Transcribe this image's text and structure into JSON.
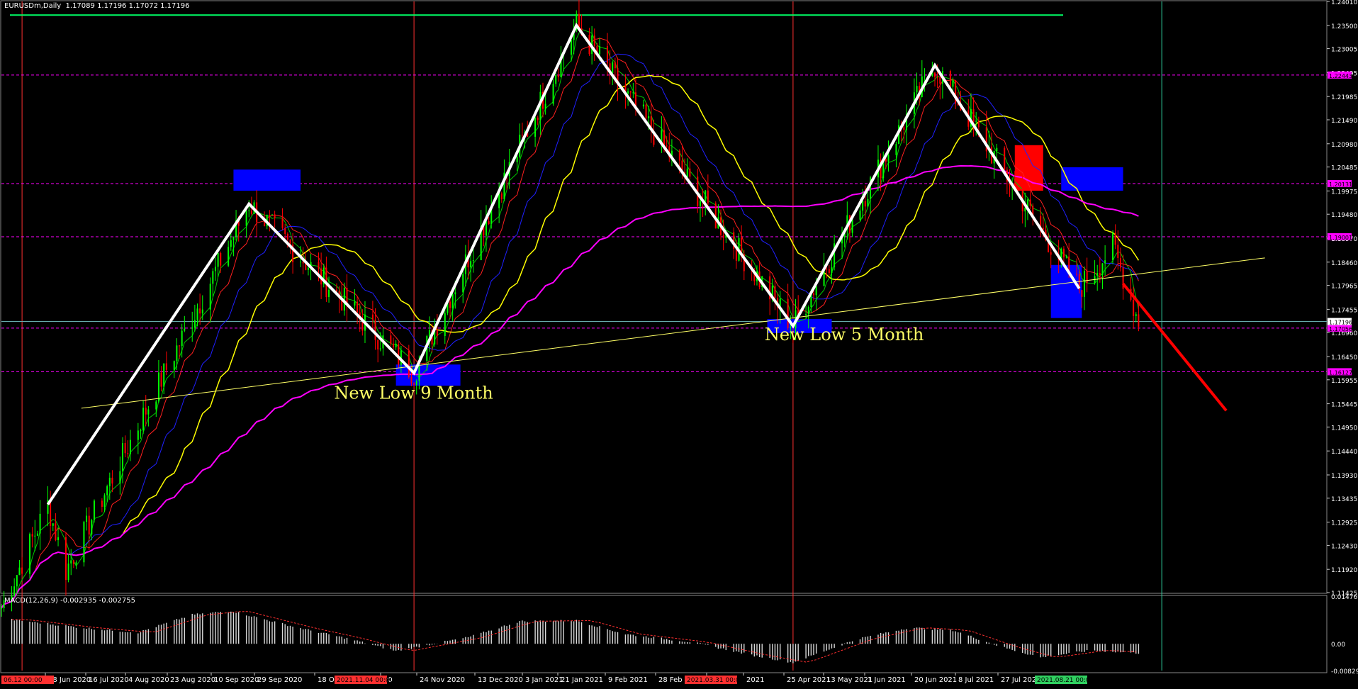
{
  "window": {
    "title": "EURUSDm,Daily  1.17089 1.17196 1.17072 1.17196"
  },
  "macd": {
    "header": "MACD(12,26,9) -0.002935 -0.002755"
  },
  "colors": {
    "background": "#000000",
    "bull": "#00ff00",
    "bear": "#ff0000",
    "ma_fast": "#00c800",
    "ma_mid": "#ff2020",
    "ma_slow": "#2020ff",
    "ma_yellow": "#ffff00",
    "ma_magenta": "#ff00ff",
    "trendline": "#ffff66",
    "zigzag": "#ffffff",
    "box_blue": "#0000ff",
    "box_red": "#ff0000",
    "hline": "#ff00ff",
    "top_line": "#00ff66",
    "annotation": "#ffff66"
  },
  "chart_data": {
    "type": "candlestick",
    "symbol": "EURUSDm",
    "timeframe": "Daily",
    "ylim": [
      1.11425,
      1.2401
    ],
    "price_ticks": [
      "1.24010",
      "1.23500",
      "1.23005",
      "1.22495",
      "1.21985",
      "1.21490",
      "1.20980",
      "1.20485",
      "1.19975",
      "1.19480",
      "1.18970",
      "1.18460",
      "1.17965",
      "1.17455",
      "1.16960",
      "1.16450",
      "1.15955",
      "1.15445",
      "1.14950",
      "1.14440",
      "1.13930",
      "1.13435",
      "1.12925",
      "1.12430",
      "1.11920",
      "1.11425"
    ],
    "time_labels": [
      "28 Jun 2020",
      "16 Jul 2020",
      "4 Aug 2020",
      "23 Aug 2020",
      "10 Sep 2020",
      "29 Sep 2020",
      "18 O",
      "20",
      "24 Nov 2020",
      "13 Dec 2020",
      "3 Jan 2021",
      "21 Jan 2021",
      "9 Feb 2021",
      "28 Feb 2021",
      "1",
      "2021",
      "25 Apr 2021",
      "13 May 2021",
      "1 Jun 2021",
      "20 Jun 2021",
      "8 Jul 2021",
      "27 Jul 2021"
    ],
    "time_markers": [
      "06.12 00:00",
      "2021.11.04 00:00",
      "2021.03.31 00:00",
      "2021.08.21 00:00"
    ],
    "current_price": "1.17196",
    "hlines": [
      {
        "price": 1.22443,
        "label": "1.22443"
      },
      {
        "price": 1.20131,
        "label": "1.20131"
      },
      {
        "price": 1.19001,
        "label": "1.19001"
      },
      {
        "price": 1.17056,
        "label": "1.17056"
      },
      {
        "price": 1.16127,
        "label": "1.16127"
      }
    ],
    "top_line_price": 1.2372,
    "annotations": [
      "New Low 9 Month",
      "New Low 5 Month"
    ],
    "zigzag": [
      {
        "date": "2020-06-15",
        "price": 1.133
      },
      {
        "date": "2020-09-01",
        "price": 1.197
      },
      {
        "date": "2020-11-04",
        "price": 1.161
      },
      {
        "date": "2021-01-06",
        "price": 1.235
      },
      {
        "date": "2021-03-31",
        "price": 1.171
      },
      {
        "date": "2021-05-25",
        "price": 1.2265
      },
      {
        "date": "2021-07-20",
        "price": 1.179
      }
    ],
    "forecast": [
      {
        "date": "2021-08-06",
        "price": 1.18
      },
      {
        "date": "2021-09-15",
        "price": 1.153
      }
    ],
    "trendline": [
      {
        "date": "2020-06-28",
        "price": 1.1535
      },
      {
        "date": "2021-09-30",
        "price": 1.1855
      }
    ],
    "zones": [
      {
        "color": "blue",
        "date_from": "2020-08-26",
        "date_to": "2020-09-21",
        "price_top": 1.2043,
        "price_bottom": 1.1998
      },
      {
        "color": "blue",
        "date_from": "2020-10-28",
        "date_to": "2020-11-22",
        "price_top": 1.1628,
        "price_bottom": 1.1583
      },
      {
        "color": "blue",
        "date_from": "2021-03-21",
        "date_to": "2021-04-15",
        "price_top": 1.1725,
        "price_bottom": 1.1695
      },
      {
        "color": "red",
        "date_from": "2021-06-25",
        "date_to": "2021-07-06",
        "price_top": 1.2095,
        "price_bottom": 1.1998
      },
      {
        "color": "blue",
        "date_from": "2021-07-13",
        "date_to": "2021-08-06",
        "price_top": 1.2048,
        "price_bottom": 1.1998
      },
      {
        "color": "blue",
        "date_from": "2021-07-09",
        "date_to": "2021-07-21",
        "price_top": 1.184,
        "price_bottom": 1.1727
      }
    ],
    "macd_ticks": [
      "0.014769",
      "0.00",
      "-0.008294"
    ],
    "macd_ylim": [
      -0.008294,
      0.014769
    ],
    "macd_path": [
      {
        "date": "2020-06-01",
        "value": 0.0075
      },
      {
        "date": "2020-06-28",
        "value": 0.005
      },
      {
        "date": "2020-07-20",
        "value": 0.0035
      },
      {
        "date": "2020-08-10",
        "value": 0.009
      },
      {
        "date": "2020-08-25",
        "value": 0.0102
      },
      {
        "date": "2020-09-20",
        "value": 0.005
      },
      {
        "date": "2020-10-10",
        "value": 0.0015
      },
      {
        "date": "2020-10-28",
        "value": -0.0022
      },
      {
        "date": "2020-11-25",
        "value": 0.002
      },
      {
        "date": "2020-12-15",
        "value": 0.007
      },
      {
        "date": "2021-01-06",
        "value": 0.0072
      },
      {
        "date": "2021-01-25",
        "value": 0.003
      },
      {
        "date": "2021-02-20",
        "value": 0.0005
      },
      {
        "date": "2021-03-15",
        "value": -0.0035
      },
      {
        "date": "2021-03-31",
        "value": -0.0058
      },
      {
        "date": "2021-04-25",
        "value": 0.0015
      },
      {
        "date": "2021-05-15",
        "value": 0.005
      },
      {
        "date": "2021-06-01",
        "value": 0.0042
      },
      {
        "date": "2021-06-20",
        "value": -0.001
      },
      {
        "date": "2021-07-05",
        "value": -0.0042
      },
      {
        "date": "2021-07-25",
        "value": -0.002
      },
      {
        "date": "2021-08-12",
        "value": -0.0029
      }
    ]
  }
}
